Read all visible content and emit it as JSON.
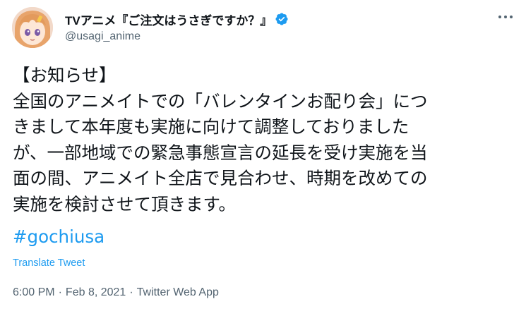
{
  "account": {
    "display_name": "TVアニメ『ご注文はうさぎですか？』",
    "handle": "@usagi_anime",
    "verified_icon": "verified-badge-icon",
    "avatar_icon": "avatar-anime-girl"
  },
  "more_icon": "more-options-icon",
  "tweet": {
    "lines": [
      "【お知らせ】",
      "全国のアニメイトでの「バレンタインお配り会」につ",
      "きまして本年度も実施に向けて調整しておりました",
      "が、一部地域での緊急事態宣言の延長を受け実施を当",
      "面の間、アニメイト全店で見合わせ、時期を改めての",
      "実施を検討させて頂きます。"
    ],
    "hashtag": "#gochiusa"
  },
  "translate_label": "Translate Tweet",
  "meta": {
    "time": "6:00 PM",
    "date": "Feb 8, 2021",
    "source": "Twitter Web App",
    "separator": "·"
  },
  "colors": {
    "text": "#0f1419",
    "secondary": "#536471",
    "link": "#1d9bf0"
  }
}
